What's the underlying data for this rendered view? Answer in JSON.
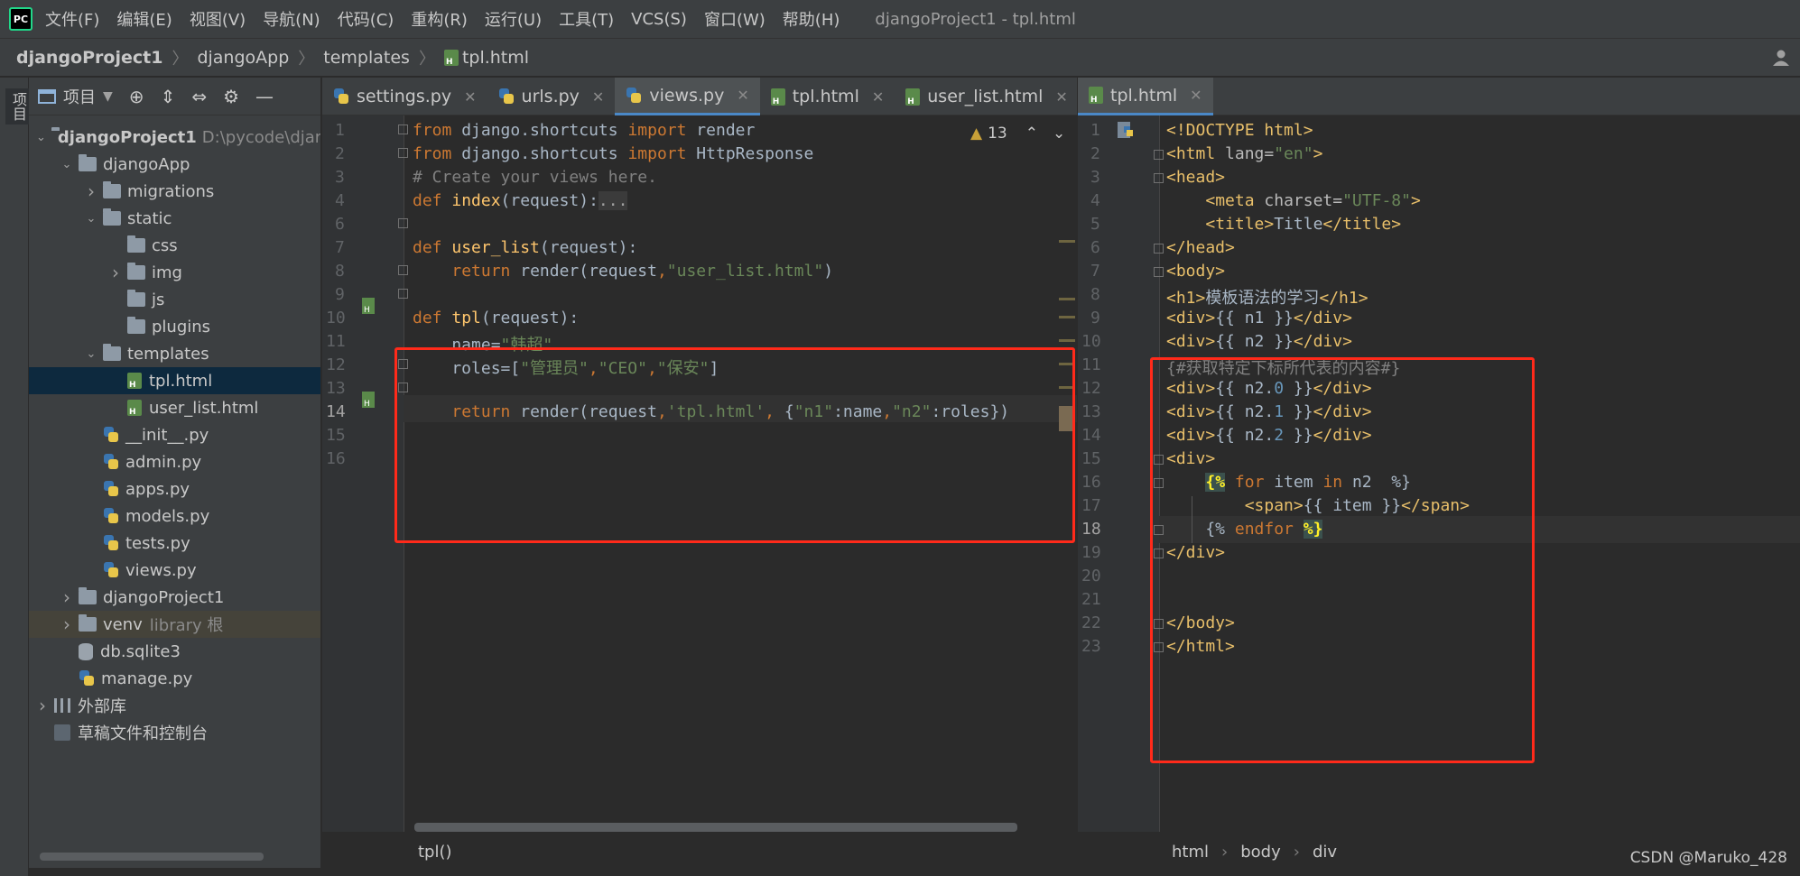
{
  "menubar": {
    "logo": "PC",
    "items": [
      "文件(F)",
      "编辑(E)",
      "视图(V)",
      "导航(N)",
      "代码(C)",
      "重构(R)",
      "运行(U)",
      "工具(T)",
      "VCS(S)",
      "窗口(W)",
      "帮助(H)"
    ],
    "window_title": "djangoProject1 - tpl.html"
  },
  "breadcrumb": [
    "djangoProject1",
    "djangoApp",
    "templates",
    "tpl.html"
  ],
  "toolstrip": {
    "label": "项目"
  },
  "project_panel": {
    "title": "项目",
    "tree": [
      {
        "label": "djangoProject1",
        "hint": "D:\\pycode\\djar",
        "type": "folder",
        "depth": 0,
        "chev": "open",
        "bold": true
      },
      {
        "label": "djangoApp",
        "type": "folder",
        "depth": 1,
        "chev": "open"
      },
      {
        "label": "migrations",
        "type": "folder",
        "depth": 2,
        "chev": "closed"
      },
      {
        "label": "static",
        "type": "folder",
        "depth": 2,
        "chev": "open"
      },
      {
        "label": "css",
        "type": "folder",
        "depth": 3,
        "chev": "none"
      },
      {
        "label": "img",
        "type": "folder",
        "depth": 3,
        "chev": "closed"
      },
      {
        "label": "js",
        "type": "folder",
        "depth": 3,
        "chev": "none"
      },
      {
        "label": "plugins",
        "type": "folder",
        "depth": 3,
        "chev": "none"
      },
      {
        "label": "templates",
        "type": "folder",
        "depth": 2,
        "chev": "open"
      },
      {
        "label": "tpl.html",
        "type": "html",
        "depth": 3,
        "chev": "none",
        "selected": true
      },
      {
        "label": "user_list.html",
        "type": "html",
        "depth": 3,
        "chev": "none"
      },
      {
        "label": "__init__.py",
        "type": "py",
        "depth": 2,
        "chev": "none"
      },
      {
        "label": "admin.py",
        "type": "py",
        "depth": 2,
        "chev": "none"
      },
      {
        "label": "apps.py",
        "type": "py",
        "depth": 2,
        "chev": "none"
      },
      {
        "label": "models.py",
        "type": "py",
        "depth": 2,
        "chev": "none"
      },
      {
        "label": "tests.py",
        "type": "py",
        "depth": 2,
        "chev": "none"
      },
      {
        "label": "views.py",
        "type": "py",
        "depth": 2,
        "chev": "none"
      },
      {
        "label": "djangoProject1",
        "type": "folder",
        "depth": 1,
        "chev": "closed"
      },
      {
        "label": "venv",
        "hint": "library 根",
        "type": "folder",
        "depth": 1,
        "chev": "closed",
        "venv": true
      },
      {
        "label": "db.sqlite3",
        "type": "db",
        "depth": 1,
        "chev": "none"
      },
      {
        "label": "manage.py",
        "type": "py",
        "depth": 1,
        "chev": "none"
      },
      {
        "label": "外部库",
        "type": "lib",
        "depth": 0,
        "chev": "closed"
      },
      {
        "label": "草稿文件和控制台",
        "type": "scratch",
        "depth": 0,
        "chev": "none"
      }
    ]
  },
  "left_editor": {
    "tabs": [
      {
        "label": "settings.py",
        "icon": "py"
      },
      {
        "label": "urls.py",
        "icon": "py"
      },
      {
        "label": "views.py",
        "icon": "py",
        "active": true
      },
      {
        "label": "tpl.html",
        "icon": "html"
      },
      {
        "label": "user_list.html",
        "icon": "html"
      }
    ],
    "warning_count": "13",
    "line_numbers": [
      "1",
      "2",
      "3",
      "4",
      "6",
      "7",
      "8",
      "9",
      "10",
      "11",
      "12",
      "13",
      "14",
      "15",
      "16"
    ],
    "status": "tpl()"
  },
  "right_editor": {
    "tabs": [
      {
        "label": "tpl.html",
        "icon": "html",
        "active": true
      }
    ],
    "line_numbers": [
      "1",
      "2",
      "3",
      "4",
      "5",
      "6",
      "7",
      "8",
      "9",
      "10",
      "11",
      "12",
      "13",
      "14",
      "15",
      "16",
      "17",
      "18",
      "19",
      "20",
      "21",
      "22",
      "23"
    ],
    "status_crumbs": [
      "html",
      "body",
      "div"
    ]
  },
  "watermark": "CSDN @Maruko_428"
}
